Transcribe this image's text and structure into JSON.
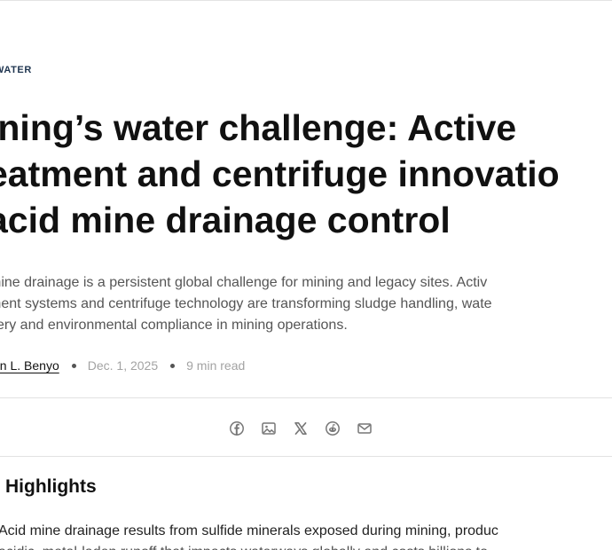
{
  "article": {
    "kicker": "WATER",
    "headline_lines": [
      "ining’s water challenge: Active",
      "eatment and centrifuge innovatio",
      "acid mine drainage control"
    ],
    "dek_lines": [
      "mine drainage is a persistent global challenge for mining and legacy sites. Activ",
      "ment systems and centrifuge technology are transforming sludge handling, wate",
      "very and environmental compliance in mining operations."
    ],
    "byline": {
      "author": "en L. Benyo",
      "date": "Dec. 1, 2025",
      "read_time": "9 min read"
    }
  },
  "share": {
    "icons": [
      "facebook-icon",
      "image-icon",
      "x-icon",
      "reddit-icon",
      "email-icon"
    ],
    "icon_color": "#777777"
  },
  "highlights": {
    "title": "r Highlights",
    "items": [
      {
        "lines": [
          "Acid mine drainage results from sulfide minerals exposed during mining, produc",
          "acidic, metal-laden runoff that impacts waterways globally and costs billions to"
        ]
      }
    ]
  }
}
